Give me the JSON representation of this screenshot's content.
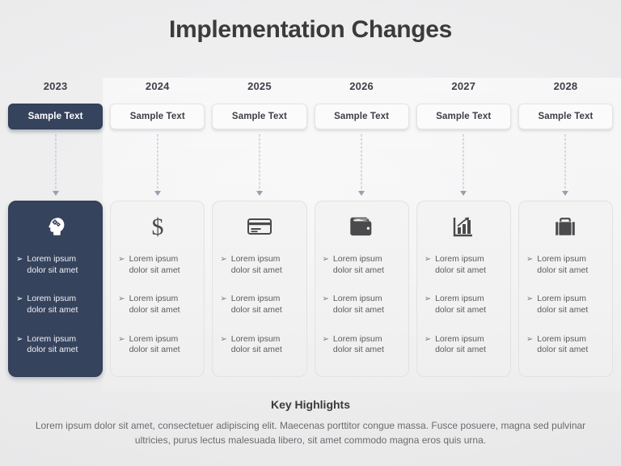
{
  "slide": {
    "title": "Implementation Changes",
    "accent_dark": "#36435d",
    "background": "#ececed",
    "text_dark": "#3b3b3d",
    "text_muted": "#5c5c5e"
  },
  "bullet_mark": "➢",
  "timeline": {
    "columns": [
      {
        "year": "2023",
        "pill_label": "Sample Text",
        "highlighted": true,
        "icon": "head-gears-icon",
        "bullets": [
          "Lorem ipsum dolor sit amet",
          "Lorem ipsum dolor sit amet",
          "Lorem ipsum dolor sit amet"
        ]
      },
      {
        "year": "2024",
        "pill_label": "Sample Text",
        "highlighted": false,
        "icon": "dollar-sign-icon",
        "bullets": [
          "Lorem ipsum dolor sit amet",
          "Lorem ipsum dolor sit amet",
          "Lorem ipsum dolor sit amet"
        ]
      },
      {
        "year": "2025",
        "pill_label": "Sample Text",
        "highlighted": false,
        "icon": "credit-card-icon",
        "bullets": [
          "Lorem ipsum dolor sit amet",
          "Lorem ipsum dolor sit amet",
          "Lorem ipsum dolor sit amet"
        ]
      },
      {
        "year": "2026",
        "pill_label": "Sample Text",
        "highlighted": false,
        "icon": "wallet-icon",
        "bullets": [
          "Lorem ipsum dolor sit amet",
          "Lorem ipsum dolor sit amet",
          "Lorem ipsum dolor sit amet"
        ]
      },
      {
        "year": "2027",
        "pill_label": "Sample Text",
        "highlighted": false,
        "icon": "bar-chart-growth-icon",
        "bullets": [
          "Lorem ipsum dolor sit amet",
          "Lorem ipsum dolor sit amet",
          "Lorem ipsum dolor sit amet"
        ]
      },
      {
        "year": "2028",
        "pill_label": "Sample Text",
        "highlighted": false,
        "icon": "briefcase-icon",
        "bullets": [
          "Lorem ipsum dolor sit amet",
          "Lorem ipsum dolor sit amet",
          "Lorem ipsum dolor sit amet"
        ]
      }
    ]
  },
  "footer": {
    "title": "Key Highlights",
    "body": "Lorem ipsum dolor sit amet, consectetuer adipiscing elit. Maecenas porttitor congue massa. Fusce posuere, magna sed pulvinar ultricies, purus lectus malesuada libero, sit amet commodo magna eros quis urna."
  }
}
